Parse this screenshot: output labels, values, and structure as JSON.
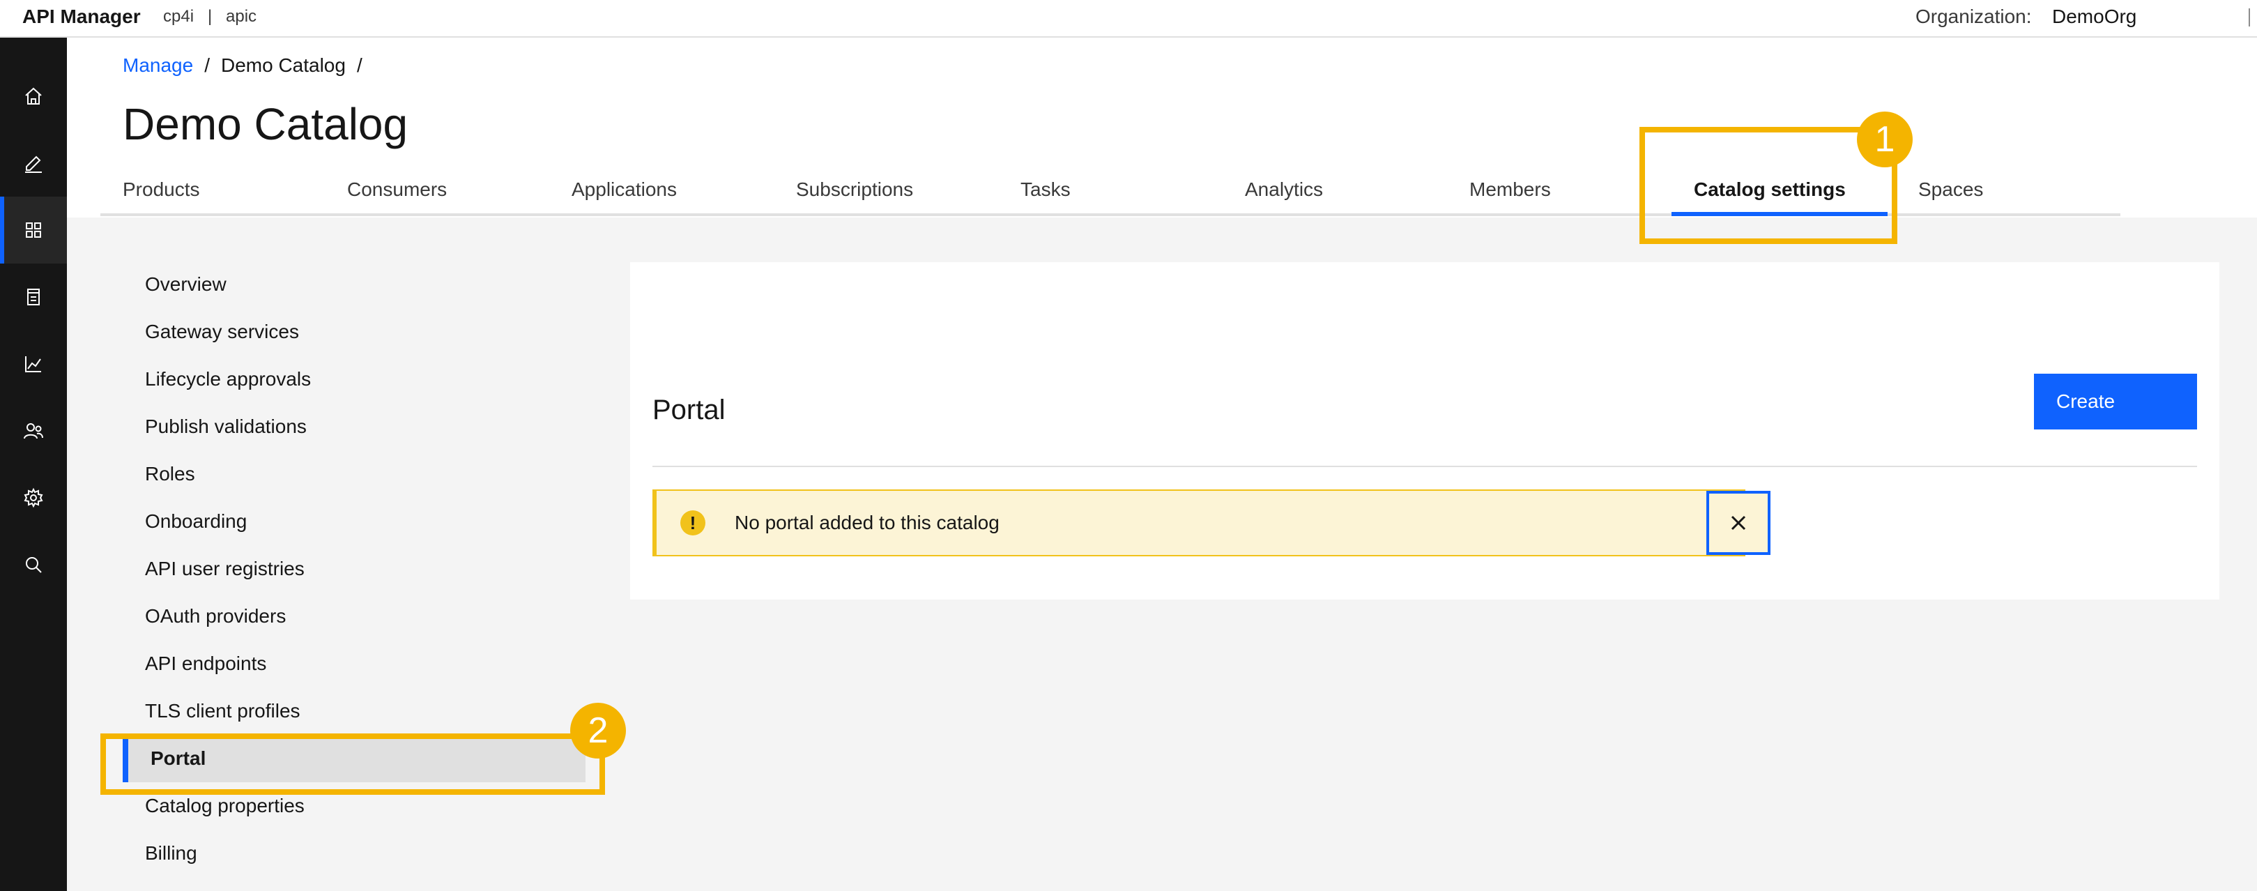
{
  "topbar": {
    "brand": "API Manager",
    "env1": "cp4i",
    "env_sep": "|",
    "env2": "apic",
    "org_label": "Organization:",
    "org_value": "DemoOrg"
  },
  "sidenav": {
    "icons": [
      "home-icon",
      "edit-icon",
      "grid-icon",
      "document-icon",
      "chart-icon",
      "users-icon",
      "gear-icon",
      "search-icon"
    ],
    "active_index": 2
  },
  "breadcrumb": {
    "root": "Manage",
    "sep": "/",
    "current": "Demo Catalog"
  },
  "page_title": "Demo Catalog",
  "tabs": [
    "Products",
    "Consumers",
    "Applications",
    "Subscriptions",
    "Tasks",
    "Analytics",
    "Members",
    "Catalog settings",
    "Spaces"
  ],
  "active_tab": "Catalog settings",
  "settings_nav": [
    "Overview",
    "Gateway services",
    "Lifecycle approvals",
    "Publish validations",
    "Roles",
    "Onboarding",
    "API user registries",
    "OAuth providers",
    "API endpoints",
    "TLS client profiles",
    "Portal",
    "Catalog properties",
    "Billing"
  ],
  "settings_nav_active": "Portal",
  "panel": {
    "title": "Portal",
    "create_label": "Create",
    "notice_text": "No portal added to this catalog",
    "notice_icon": "warning-icon",
    "close_icon": "close-icon"
  },
  "callouts": {
    "one": "1",
    "two": "2"
  },
  "colors": {
    "accent": "#0f62fe",
    "callout": "#f4b400",
    "warning": "#f1c21b",
    "sidenav": "#161616"
  }
}
